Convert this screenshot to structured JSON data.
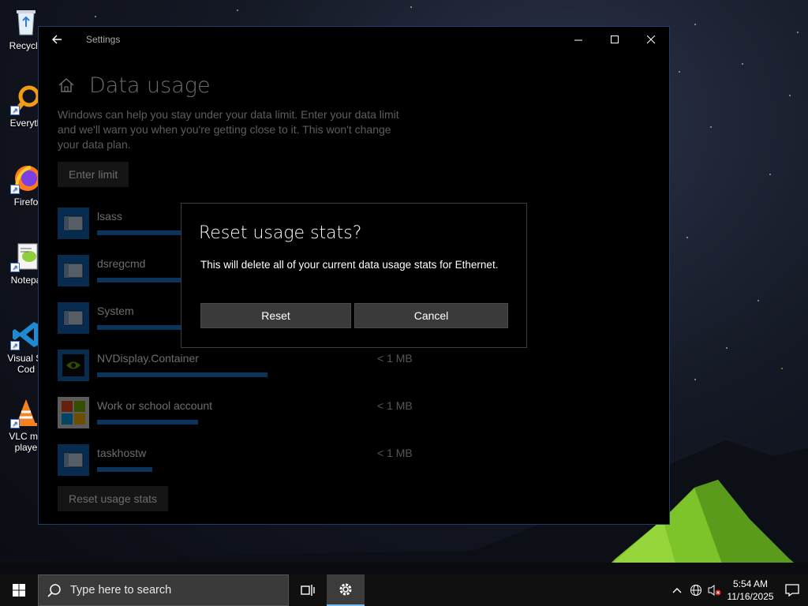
{
  "desktop": {
    "icons": [
      {
        "label": "Recycle",
        "icon": "recycle-bin-icon"
      },
      {
        "label": "Everyth",
        "icon": "everything-search-icon"
      },
      {
        "label": "Firefo",
        "icon": "firefox-icon"
      },
      {
        "label": "Notepa",
        "icon": "notepad-plus-icon"
      },
      {
        "label": "Visual St Cod",
        "icon": "vscode-icon"
      },
      {
        "label": "VLC me playe",
        "icon": "vlc-icon"
      }
    ]
  },
  "window": {
    "title": "Settings",
    "page_title": "Data usage",
    "description": "Windows can help you stay under your data limit. Enter your data limit and we'll warn you when you're getting close to it. This won't change your data plan.",
    "enter_limit_label": "Enter limit",
    "reset_stats_label": "Reset usage stats",
    "apps": [
      {
        "name": "lsass",
        "size": "",
        "usage": 0.49,
        "icon": "generic-app-icon"
      },
      {
        "name": "dsregcmd",
        "size": "",
        "usage": 0.49,
        "icon": "generic-app-icon"
      },
      {
        "name": "System",
        "size": "",
        "usage": 0.49,
        "icon": "generic-app-icon"
      },
      {
        "name": "NVDisplay.Container",
        "size": "< 1 MB",
        "usage": 0.49,
        "icon": "nvidia-icon"
      },
      {
        "name": "Work or school account",
        "size": "< 1 MB",
        "usage": 0.29,
        "icon": "microsoft-logo-icon"
      },
      {
        "name": "taskhostw",
        "size": "< 1 MB",
        "usage": 0.16,
        "icon": "generic-app-icon"
      }
    ]
  },
  "dialog": {
    "title": "Reset usage stats?",
    "message": "This will delete all of your current data usage stats for Ethernet.",
    "reset_label": "Reset",
    "cancel_label": "Cancel"
  },
  "taskbar": {
    "search_placeholder": "Type here to search",
    "time": "5:54 AM",
    "date": "11/16/2025"
  },
  "colors": {
    "accent": "#1e7ad8",
    "taskbar_active": "#76b9ed"
  }
}
